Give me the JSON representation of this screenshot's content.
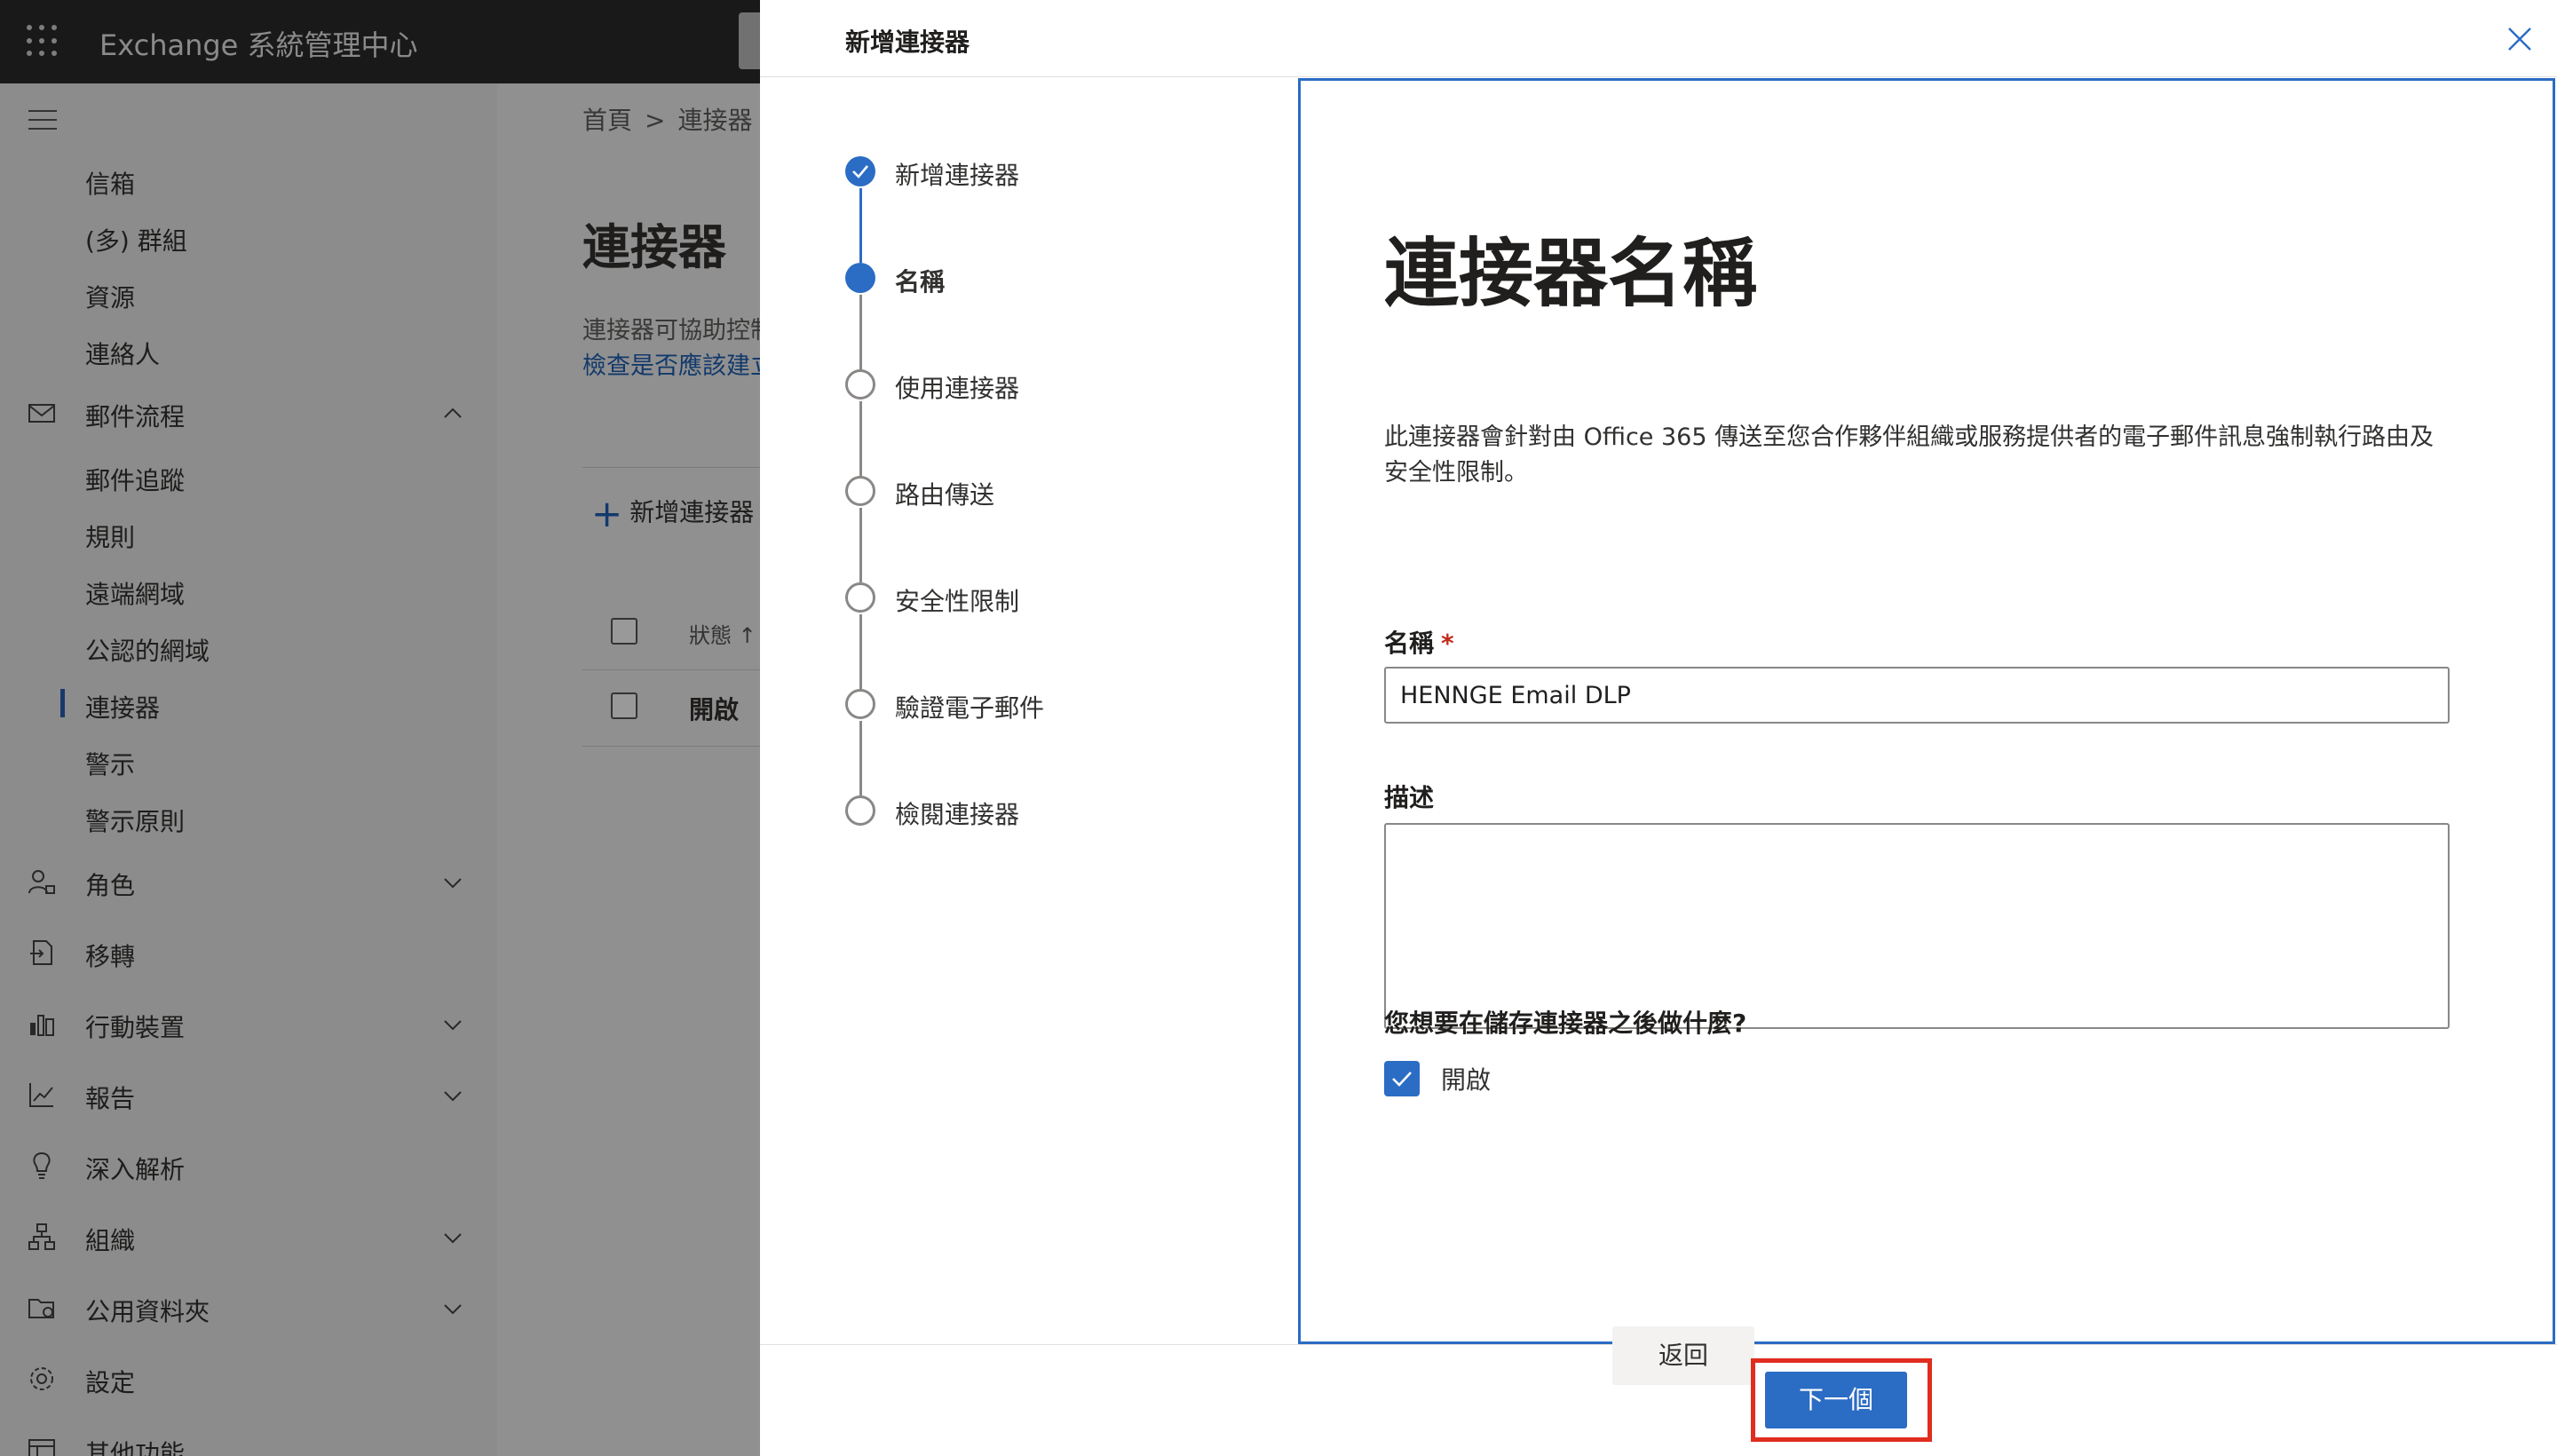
{
  "header": {
    "app_title": "Exchange 系統管理中心"
  },
  "nav": {
    "items": [
      {
        "label": "信箱",
        "icon": "",
        "chevron": ""
      },
      {
        "label": "(多) 群組",
        "icon": "",
        "chevron": ""
      },
      {
        "label": "資源",
        "icon": "",
        "chevron": ""
      },
      {
        "label": "連絡人",
        "icon": "",
        "chevron": ""
      },
      {
        "label": "郵件流程",
        "icon": "mail-icon",
        "chevron": "up"
      },
      {
        "label": "郵件追蹤",
        "icon": "",
        "chevron": ""
      },
      {
        "label": "規則",
        "icon": "",
        "chevron": ""
      },
      {
        "label": "遠端網域",
        "icon": "",
        "chevron": ""
      },
      {
        "label": "公認的網域",
        "icon": "",
        "chevron": ""
      },
      {
        "label": "連接器",
        "icon": "",
        "chevron": "",
        "active": true
      },
      {
        "label": "警示",
        "icon": "",
        "chevron": ""
      },
      {
        "label": "警示原則",
        "icon": "",
        "chevron": ""
      },
      {
        "label": "角色",
        "icon": "roles-icon",
        "chevron": "down"
      },
      {
        "label": "移轉",
        "icon": "migration-icon",
        "chevron": ""
      },
      {
        "label": "行動裝置",
        "icon": "mobile-icon",
        "chevron": "down"
      },
      {
        "label": "報告",
        "icon": "reports-icon",
        "chevron": "down"
      },
      {
        "label": "深入解析",
        "icon": "insights-icon",
        "chevron": ""
      },
      {
        "label": "組織",
        "icon": "org-icon",
        "chevron": "down"
      },
      {
        "label": "公用資料夾",
        "icon": "folder-icon",
        "chevron": "down"
      },
      {
        "label": "設定",
        "icon": "gear-icon",
        "chevron": ""
      },
      {
        "label": "其他功能",
        "icon": "more-icon",
        "chevron": ""
      }
    ]
  },
  "page": {
    "breadcrumb": [
      "首頁",
      "連接器"
    ],
    "title": "連接器",
    "description": "連接器可協助控制",
    "link": "檢查是否應該建立",
    "add_button": "新增連接器",
    "table": {
      "status_header": "狀態 ↑",
      "row_status": "開啟"
    }
  },
  "panel": {
    "title": "新增連接器",
    "steps": [
      {
        "label": "新增連接器",
        "state": "done"
      },
      {
        "label": "名稱",
        "state": "current"
      },
      {
        "label": "使用連接器",
        "state": "todo"
      },
      {
        "label": "路由傳送",
        "state": "todo"
      },
      {
        "label": "安全性限制",
        "state": "todo"
      },
      {
        "label": "驗證電子郵件",
        "state": "todo"
      },
      {
        "label": "檢閱連接器",
        "state": "todo"
      }
    ],
    "form": {
      "heading": "連接器名稱",
      "description": "此連接器會針對由 Office 365 傳送至您合作夥伴組織或服務提供者的電子郵件訊息強制執行路由及安全性限制。",
      "name_label": "名稱",
      "required_mark": "*",
      "name_value": "HENNGE Email DLP",
      "desc_label": "描述",
      "desc_value": "",
      "question": "您想要在儲存連接器之後做什麼?",
      "checkbox_label": "開啟",
      "checkbox_checked": true
    },
    "buttons": {
      "back": "返回",
      "next": "下一個"
    }
  },
  "colors": {
    "accent": "#2b6cc4",
    "highlight": "#e02d1f",
    "header_bg": "#2b2b2b"
  }
}
